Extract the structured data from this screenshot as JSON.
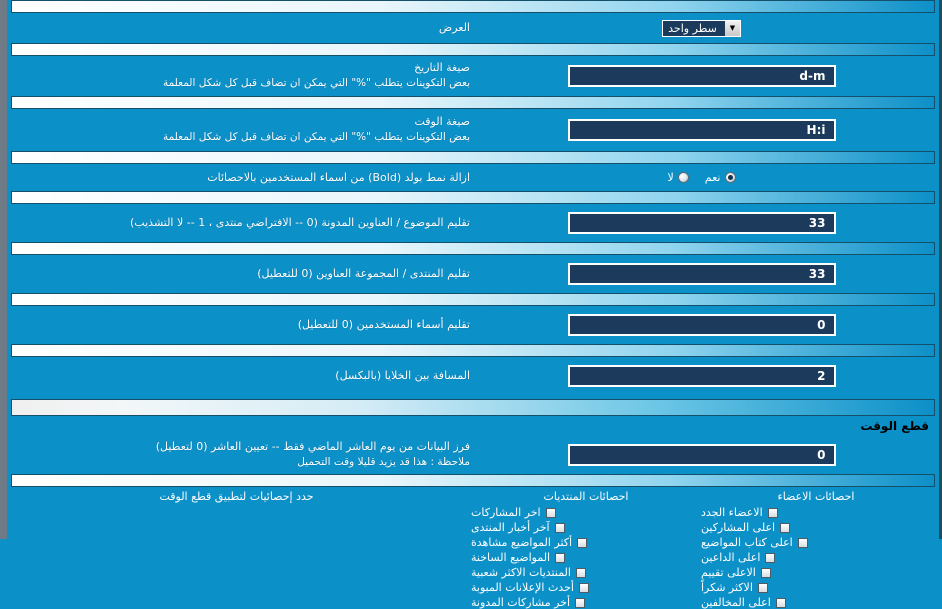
{
  "theme": {
    "bg": "#0c90c8",
    "input_bg": "#1b3a5c",
    "border": "#15506b",
    "text": "#ffffff",
    "section_title_color": "#000000"
  },
  "rows": {
    "display": {
      "label": "العرض",
      "select_value": "سطر واحد",
      "arrow_icon": "chevron-down-icon"
    },
    "date_format": {
      "label": "صيغة التاريخ",
      "sub": "بعض التكوينات يتطلب \"%\" التي يمكن ان تضاف قبل كل شكل المعلمة",
      "value": "d-m"
    },
    "time_format": {
      "label": "صيغة الوقت",
      "sub": "بعض التكوينات يتطلب \"%\" التي يمكن ان تضاف قبل كل شكل المعلمة",
      "value": "H:i"
    },
    "remove_bold": {
      "label": "ازالة نمط بولد (Bold) من اسماء المستخدمين بالاحصائات",
      "options": [
        {
          "label": "نعم",
          "selected": true
        },
        {
          "label": "لا",
          "selected": false
        }
      ]
    },
    "trim_thread": {
      "label": "تقليم الموضوع / العناوين المدونة (0 -- الافتراضي منتدى ، 1 -- لا التشذيب)",
      "value": "33"
    },
    "trim_forum": {
      "label": "تقليم المنتدى / المجموعة العناوين (0 للتعطيل)",
      "value": "33"
    },
    "trim_username": {
      "label": "تقليم أسماء المستخدمين (0 للتعطيل)",
      "value": "0"
    },
    "cell_spacing": {
      "label": "المسافة بين الخلايا (بالبكسل)",
      "value": "2"
    }
  },
  "time_cut_section": {
    "title": "قطع الوقت",
    "sort_row": {
      "label_line1": "فرز البيانات من يوم العاشر الماضي فقط -- تعيين العاشر (0 لتعطيل)",
      "label_line2": "ملاحظة : هذا قد يزيد قليلا وقت التحميل",
      "value": "0"
    },
    "columns": {
      "prompt": "حدد إحصائيات لتطبيق قطع الوقت",
      "forums_header": "احصائات المنتديات",
      "members_header": "احصائات الاعضاء"
    },
    "forums_options": [
      {
        "label": "اخر المشاركات",
        "checked": false
      },
      {
        "label": "آخر أخبار المنتدى",
        "checked": false
      },
      {
        "label": "أكثر المواضيع مشاهدة",
        "checked": false
      },
      {
        "label": "المواضيع الساخنة",
        "checked": false
      },
      {
        "label": "المنتديات الاكثر شعبية",
        "checked": false
      },
      {
        "label": "أحدث الإعلانات المبوبة",
        "checked": false
      },
      {
        "label": "أخر مشاركات المدونة",
        "checked": false
      }
    ],
    "members_options": [
      {
        "label": "الاعضاء الجدد",
        "checked": false
      },
      {
        "label": "اعلى المشاركين",
        "checked": false
      },
      {
        "label": "اعلى كتاب المواضيع",
        "checked": false
      },
      {
        "label": "اعلى الداعين",
        "checked": false
      },
      {
        "label": "الاعلى تقييم",
        "checked": false
      },
      {
        "label": "الاكثر شكراً",
        "checked": false
      },
      {
        "label": "اعلى المخالفين",
        "checked": false
      }
    ]
  }
}
